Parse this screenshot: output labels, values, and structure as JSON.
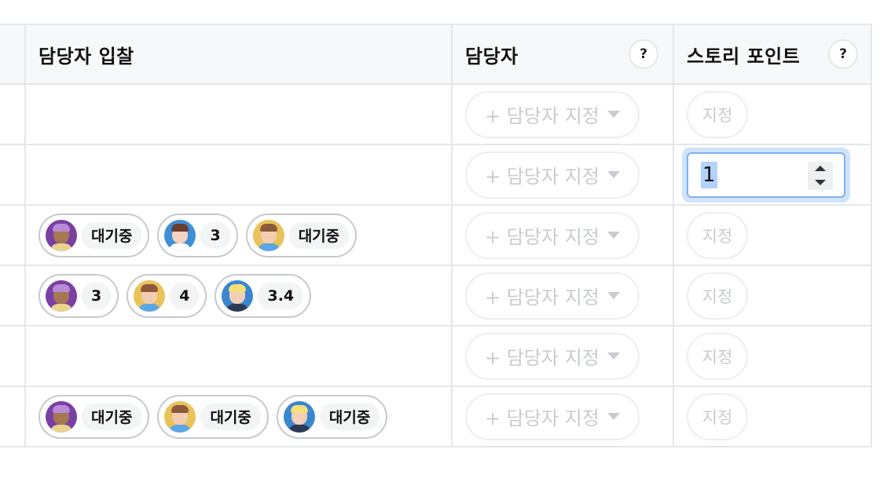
{
  "header": {
    "bids_label": "담당자 입찰",
    "assignee_label": "담당자",
    "points_label": "스토리 포인트",
    "help_glyph": "?"
  },
  "assign_button": {
    "label": "+ 담당자 지정"
  },
  "point_button": {
    "label": "지정"
  },
  "rows": [
    {
      "bids": [],
      "point_mode": "button"
    },
    {
      "bids": [],
      "point_mode": "input",
      "point_value": "1"
    },
    {
      "bids": [
        {
          "avatar": "purple",
          "value": "대기중"
        },
        {
          "avatar": "blue",
          "value": "3"
        },
        {
          "avatar": "yellow",
          "value": "대기중"
        }
      ],
      "point_mode": "button"
    },
    {
      "bids": [
        {
          "avatar": "purple",
          "value": "3"
        },
        {
          "avatar": "yellow",
          "value": "4"
        },
        {
          "avatar": "cool",
          "value": "3.4"
        }
      ],
      "point_mode": "button"
    },
    {
      "bids": [],
      "point_mode": "button"
    },
    {
      "bids": [
        {
          "avatar": "purple",
          "value": "대기중"
        },
        {
          "avatar": "yellow",
          "value": "대기중"
        },
        {
          "avatar": "cool",
          "value": "대기중"
        }
      ],
      "point_mode": "button"
    }
  ],
  "colors": {
    "border": "#e4e6e9",
    "header_bg": "#f7f8fa",
    "focus_ring": "#cfe3fb",
    "input_border": "#7fb0f1",
    "selection": "#b3d2fb"
  }
}
